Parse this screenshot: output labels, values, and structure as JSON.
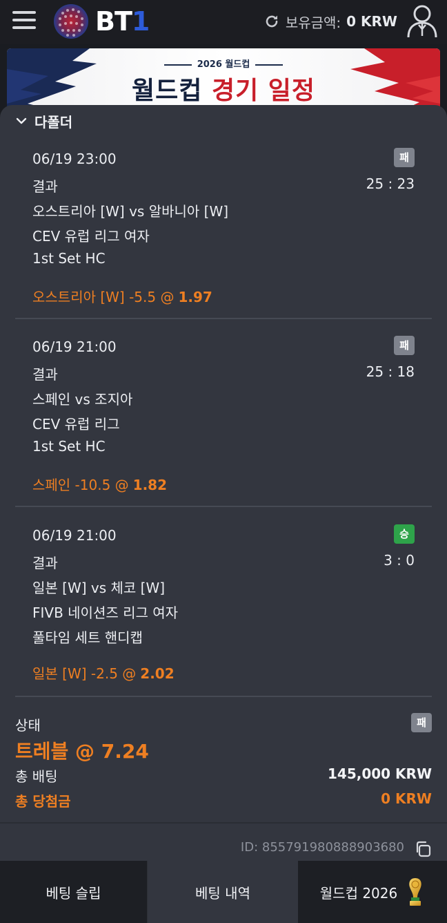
{
  "header": {
    "logo_text_a": "BT",
    "logo_text_b": "1",
    "balance_label": "보유금액:",
    "balance_value": "0 KRW",
    "icons": [
      "hamburger-menu-icon",
      "refresh-icon",
      "user-icon"
    ]
  },
  "banner": {
    "subtitle": "2026 월드컵",
    "title_part1": "월드컵",
    "title_part2": "경기 일정"
  },
  "sheet": {
    "title": "다폴더",
    "bets": [
      {
        "datetime": "06/19 23:00",
        "result_label": "결과",
        "score": "25 : 23",
        "match": "오스트리아 [W] vs 알바니아 [W]",
        "league": "CEV 유럽 리그 여자",
        "market": "1st Set HC",
        "pick": "오스트리아 [W] -5.5 @",
        "odds": "1.97",
        "status": "패"
      },
      {
        "datetime": "06/19 21:00",
        "result_label": "결과",
        "score": "25 : 18",
        "match": "스페인 vs 조지아",
        "league": "CEV 유럽 리그",
        "market": "1st Set HC",
        "pick": "스페인 -10.5 @",
        "odds": "1.82",
        "status": "패"
      },
      {
        "datetime": "06/19 21:00",
        "result_label": "결과",
        "score": "3 : 0",
        "match": "일본 [W] vs 체코 [W]",
        "league": "FIVB 네이션즈 리그 여자",
        "market": "풀타임 세트 핸디캡",
        "pick": "일본 [W] -2.5 @",
        "odds": "2.02",
        "status": "승"
      }
    ],
    "summary": {
      "status_label": "상태",
      "status": "패",
      "combo": "트레블 @ 7.24",
      "stake_label": "총 배팅",
      "stake_value": "145,000 KRW",
      "win_label": "총 당첨금",
      "win_value": "0 KRW"
    },
    "bet_id": "ID: 855791980888903680"
  },
  "bottom_nav": {
    "tabs": [
      "베팅 슬립",
      "베팅 내역",
      "월드컵 2026"
    ],
    "active_index": 1
  },
  "colors": {
    "accent_orange": "#ee7f22",
    "lose_badge": "#7f838d",
    "win_badge": "#2ea34a",
    "sheet_bg": "#33363f",
    "header_bg": "#1c1d22"
  }
}
